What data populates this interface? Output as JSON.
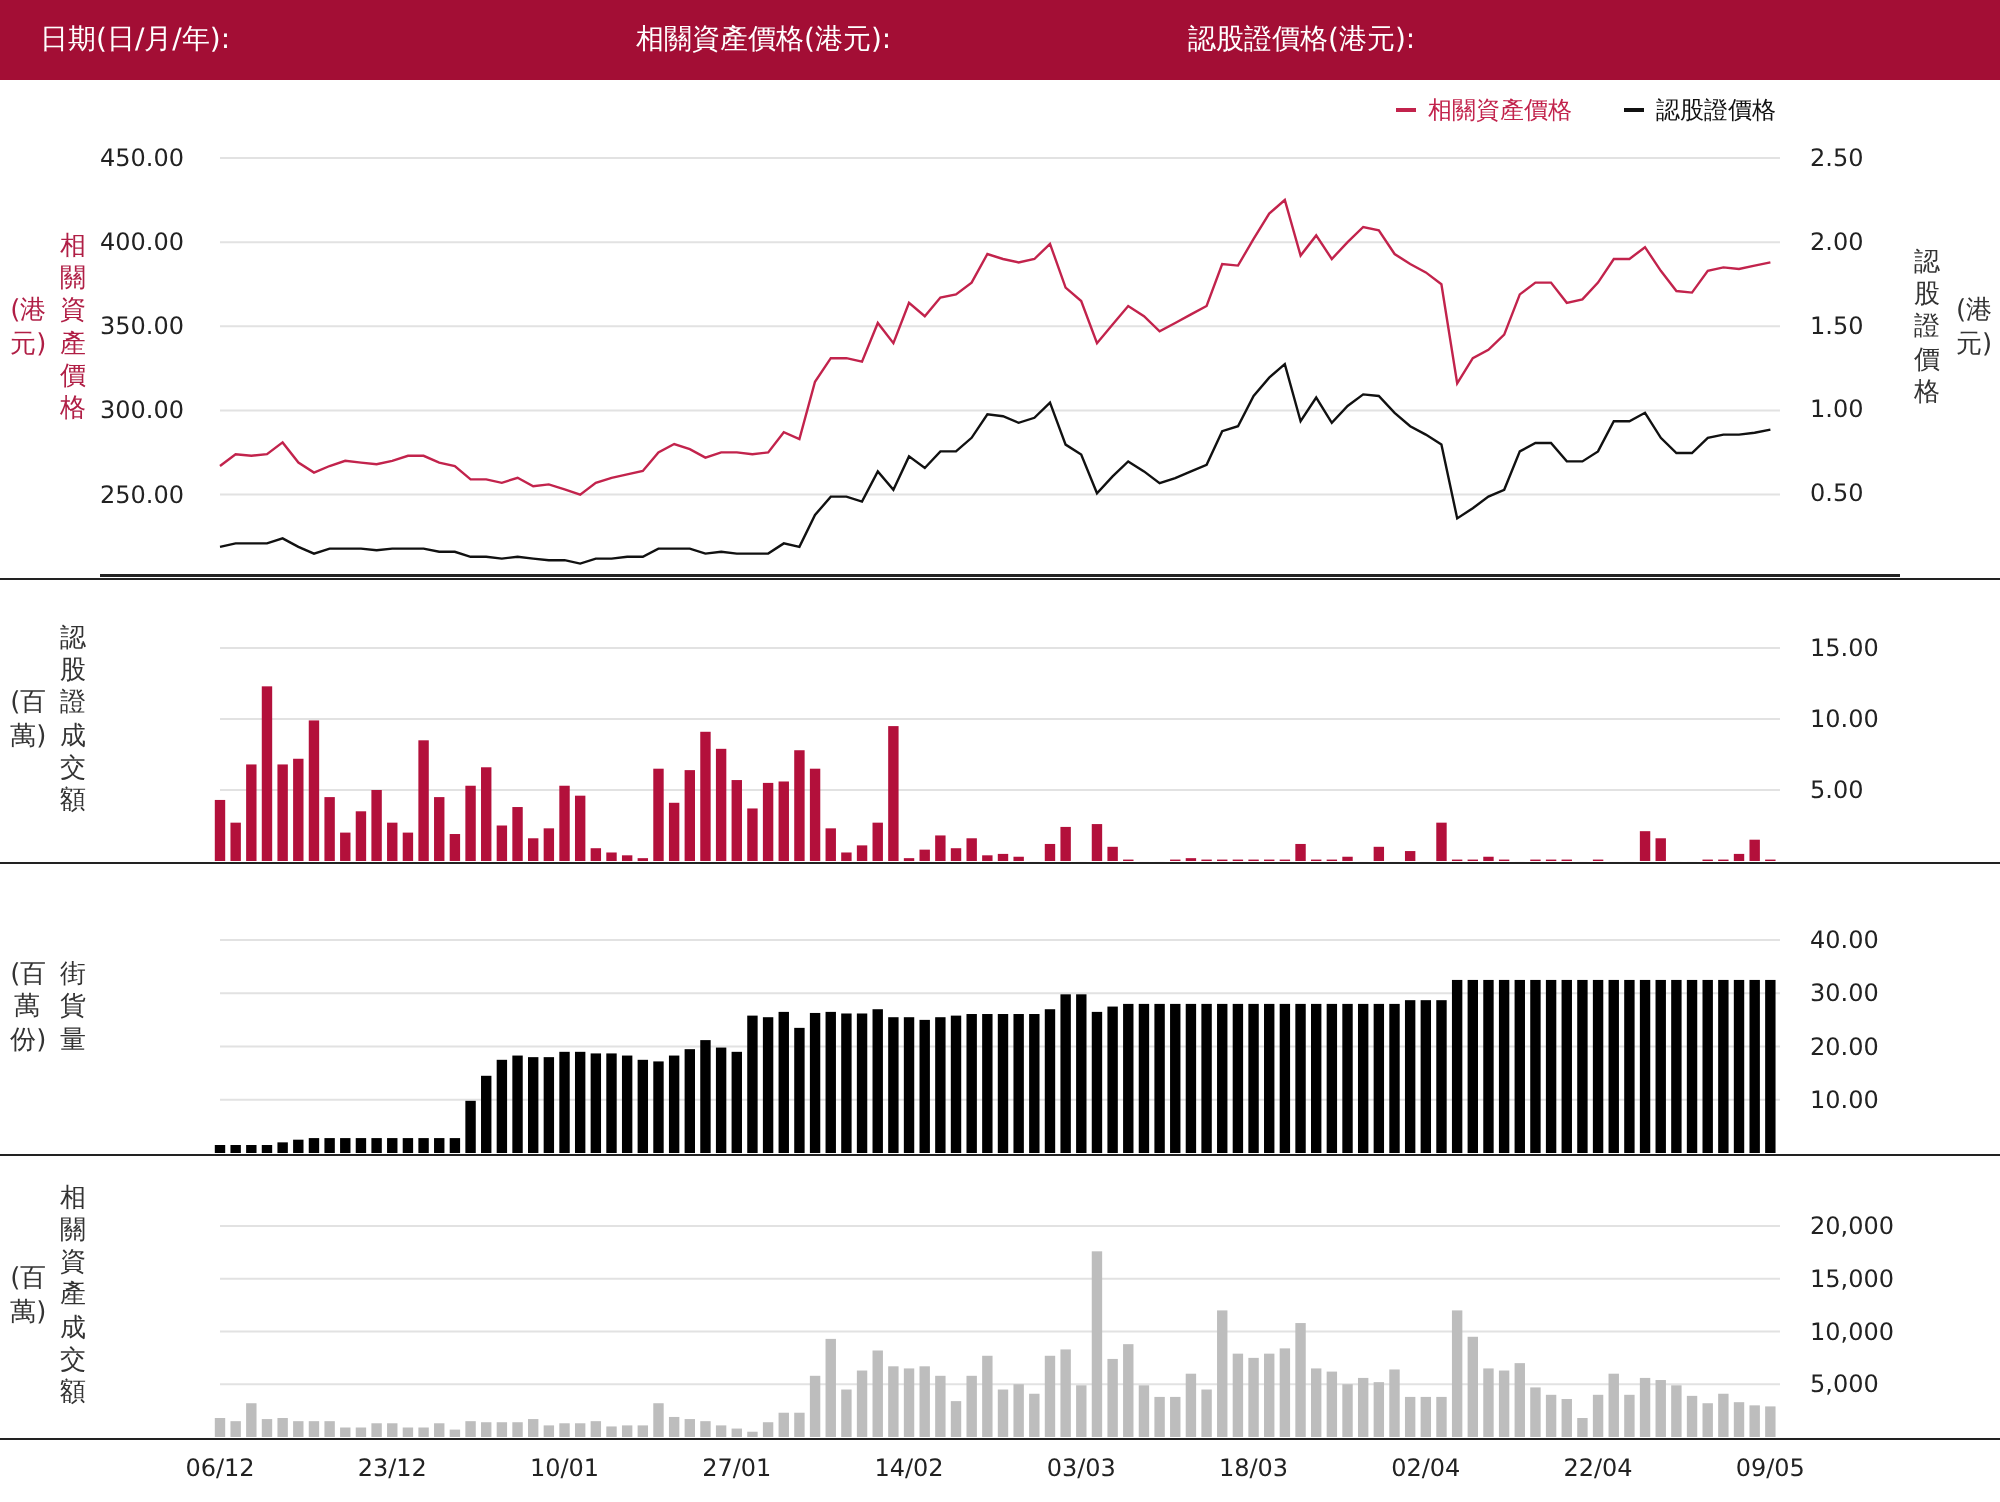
{
  "header": {
    "fields": [
      {
        "label": "日期(日/月/年):"
      },
      {
        "label": "相關資產價格(港元):"
      },
      {
        "label": "認股證價格(港元):"
      }
    ]
  },
  "panels": [
    {
      "ylabel": "相關資產價格",
      "yunit": "(港元)",
      "y2label": "認股證價格",
      "y2unit": "(港元)",
      "chart_data": {
        "type": "line",
        "grid": true,
        "ylim": [
          201,
          450
        ],
        "y2lim": [
          0,
          2.5
        ],
        "yticks": [
          {
            "value": 450,
            "label": "450.00"
          },
          {
            "value": 400,
            "label": "400.00"
          },
          {
            "value": 350,
            "label": "350.00"
          },
          {
            "value": 300,
            "label": "300.00"
          },
          {
            "value": 250,
            "label": "250.00"
          }
        ],
        "y2ticks": [
          {
            "value": 2.5,
            "label": "2.50"
          },
          {
            "value": 2,
            "label": "2.00"
          },
          {
            "value": 1.5,
            "label": "1.50"
          },
          {
            "value": 1,
            "label": "1.00"
          },
          {
            "value": 0.5,
            "label": "0.50"
          }
        ],
        "series": [
          {
            "name": "相關資產價格",
            "color": "#c2234c",
            "values": [
              267,
              274,
              273,
              274,
              281,
              269,
              263,
              267,
              270,
              269,
              268,
              270,
              273,
              273,
              269,
              267,
              259,
              259,
              257,
              260,
              255,
              256,
              253,
              250,
              257,
              260,
              262,
              264,
              275,
              280,
              277,
              272,
              275,
              275,
              274,
              275,
              287,
              283,
              317,
              331,
              331,
              329,
              352,
              340,
              364,
              356,
              367,
              369,
              376,
              393,
              390,
              388,
              390,
              399,
              373,
              365,
              340,
              351,
              362,
              356,
              347,
              352,
              357,
              362,
              387,
              386,
              402,
              417,
              425,
              392,
              404,
              390,
              400,
              409,
              407,
              393,
              387,
              382,
              375,
              316,
              331,
              336,
              345,
              369,
              376,
              376,
              364,
              366,
              376,
              390,
              390,
              397,
              383,
              371,
              370,
              383,
              385,
              384,
              386,
              388
            ]
          },
          {
            "name": "認股證價格",
            "color": "#111111",
            "axis": "y2",
            "values": [
              0.18,
              0.2,
              0.2,
              0.2,
              0.23,
              0.18,
              0.14,
              0.17,
              0.17,
              0.17,
              0.16,
              0.17,
              0.17,
              0.17,
              0.15,
              0.15,
              0.12,
              0.12,
              0.11,
              0.12,
              0.11,
              0.1,
              0.1,
              0.08,
              0.11,
              0.11,
              0.12,
              0.12,
              0.17,
              0.17,
              0.17,
              0.14,
              0.15,
              0.14,
              0.14,
              0.14,
              0.2,
              0.18,
              0.37,
              0.48,
              0.48,
              0.45,
              0.63,
              0.52,
              0.72,
              0.65,
              0.75,
              0.75,
              0.83,
              0.97,
              0.96,
              0.92,
              0.95,
              1.04,
              0.79,
              0.73,
              0.5,
              0.6,
              0.69,
              0.63,
              0.56,
              0.59,
              0.63,
              0.67,
              0.87,
              0.9,
              1.08,
              1.19,
              1.27,
              0.93,
              1.07,
              0.92,
              1.02,
              1.09,
              1.08,
              0.98,
              0.9,
              0.85,
              0.79,
              0.35,
              0.41,
              0.48,
              0.52,
              0.75,
              0.8,
              0.8,
              0.69,
              0.69,
              0.75,
              0.93,
              0.93,
              0.98,
              0.83,
              0.74,
              0.74,
              0.83,
              0.85,
              0.85,
              0.86,
              0.88
            ]
          }
        ]
      }
    },
    {
      "ylabel": "認股證成交額",
      "yunit": "(百萬)",
      "chart_data": {
        "type": "bar",
        "grid": true,
        "color": "#b3103b",
        "ylim": [
          0,
          15
        ],
        "yticks": [
          {
            "value": 15,
            "label": "15.00"
          },
          {
            "value": 10,
            "label": "10.00"
          },
          {
            "value": 5,
            "label": "5.00"
          }
        ],
        "values": [
          4.3,
          2.7,
          6.8,
          12.3,
          6.8,
          7.2,
          9.9,
          4.5,
          2.0,
          3.5,
          5.0,
          2.7,
          2.0,
          8.5,
          4.5,
          1.9,
          5.3,
          6.6,
          2.5,
          3.8,
          1.6,
          2.3,
          5.3,
          4.6,
          0.9,
          0.6,
          0.4,
          0.2,
          6.5,
          4.1,
          6.4,
          9.1,
          7.9,
          5.7,
          3.7,
          5.5,
          5.6,
          7.8,
          6.5,
          2.3,
          0.6,
          1.1,
          2.7,
          9.5,
          0.2,
          0.8,
          1.8,
          0.9,
          1.6,
          0.4,
          0.5,
          0.3,
          0,
          1.2,
          2.4,
          0,
          2.6,
          1.0,
          0.1,
          0,
          0,
          0.1,
          0.2,
          0.1,
          0.1,
          0.1,
          0.1,
          0.1,
          0.1,
          1.2,
          0.1,
          0.1,
          0.3,
          0,
          1.0,
          0,
          0.7,
          0,
          2.7,
          0.1,
          0.1,
          0.3,
          0.1,
          0,
          0.1,
          0.1,
          0.1,
          0,
          0.1,
          0,
          0,
          2.1,
          1.6,
          0,
          0,
          0.1,
          0.1,
          0.5,
          1.5,
          0.1
        ]
      }
    },
    {
      "ylabel": "街貨量",
      "yunit": "(百萬份)",
      "chart_data": {
        "type": "bar",
        "grid": true,
        "color": "#000000",
        "ylim": [
          0,
          40
        ],
        "yticks": [
          {
            "value": 40,
            "label": "40.00"
          },
          {
            "value": 30,
            "label": "30.00"
          },
          {
            "value": 20,
            "label": "20.00"
          },
          {
            "value": 10,
            "label": "10.00"
          }
        ],
        "values": [
          1.5,
          1.5,
          1.5,
          1.5,
          2,
          2.5,
          2.8,
          2.8,
          2.8,
          2.8,
          2.8,
          2.8,
          2.8,
          2.8,
          2.8,
          2.8,
          9.8,
          14.5,
          17.5,
          18.3,
          18,
          18,
          19,
          19,
          18.7,
          18.7,
          18.3,
          17.5,
          17.2,
          18.3,
          19.5,
          21.2,
          19.8,
          19,
          25.8,
          25.5,
          26.5,
          23.5,
          26.3,
          26.5,
          26.2,
          26.2,
          27,
          25.5,
          25.5,
          25,
          25.5,
          25.8,
          26.1,
          26.1,
          26.1,
          26.1,
          26.1,
          27,
          29.8,
          29.8,
          26.5,
          27.5,
          28,
          28,
          28,
          28,
          28,
          28,
          28,
          28,
          28,
          28,
          28,
          28,
          28,
          28,
          28,
          28,
          28,
          28,
          28.7,
          28.7,
          28.7,
          32.5,
          32.5,
          32.5,
          32.5,
          32.5,
          32.5,
          32.5,
          32.5,
          32.5,
          32.5,
          32.5,
          32.5,
          32.5,
          32.5,
          32.5,
          32.5,
          32.5,
          32.5,
          32.5,
          32.5,
          32.5
        ]
      }
    },
    {
      "ylabel": "相關資產成交額",
      "yunit": "(百萬)",
      "x_labels": [
        "06/12",
        "23/12",
        "10/01",
        "27/01",
        "14/02",
        "03/03",
        "18/03",
        "02/04",
        "22/04",
        "09/05"
      ],
      "chart_data": {
        "type": "bar",
        "grid": true,
        "color": "#bdbdbd",
        "ylim": [
          0,
          20000
        ],
        "yticks": [
          {
            "value": 20000,
            "label": "20,000"
          },
          {
            "value": 15000,
            "label": "15,000"
          },
          {
            "value": 10000,
            "label": "10,000"
          },
          {
            "value": 5000,
            "label": "5,000"
          }
        ],
        "values": [
          1800,
          1500,
          3200,
          1700,
          1800,
          1500,
          1500,
          1500,
          900,
          900,
          1300,
          1300,
          900,
          900,
          1300,
          700,
          1500,
          1400,
          1400,
          1400,
          1700,
          1100,
          1300,
          1300,
          1500,
          1000,
          1100,
          1100,
          3200,
          1900,
          1700,
          1500,
          1100,
          800,
          500,
          1400,
          2300,
          2300,
          5800,
          9300,
          4500,
          6300,
          8200,
          6700,
          6500,
          6700,
          5800,
          3400,
          5800,
          7700,
          4500,
          5000,
          4100,
          7700,
          8300,
          4900,
          17600,
          7400,
          8800,
          4900,
          3800,
          3800,
          6000,
          4500,
          12000,
          7900,
          7500,
          7900,
          8400,
          10800,
          6500,
          6200,
          5000,
          5600,
          5200,
          6400,
          3800,
          3800,
          3800,
          12000,
          9500,
          6500,
          6300,
          7000,
          4700,
          4000,
          3600,
          1800,
          4000,
          6000,
          4000,
          5600,
          5400,
          4900,
          3900,
          3200,
          4100,
          3300,
          3000,
          2900
        ]
      }
    }
  ]
}
